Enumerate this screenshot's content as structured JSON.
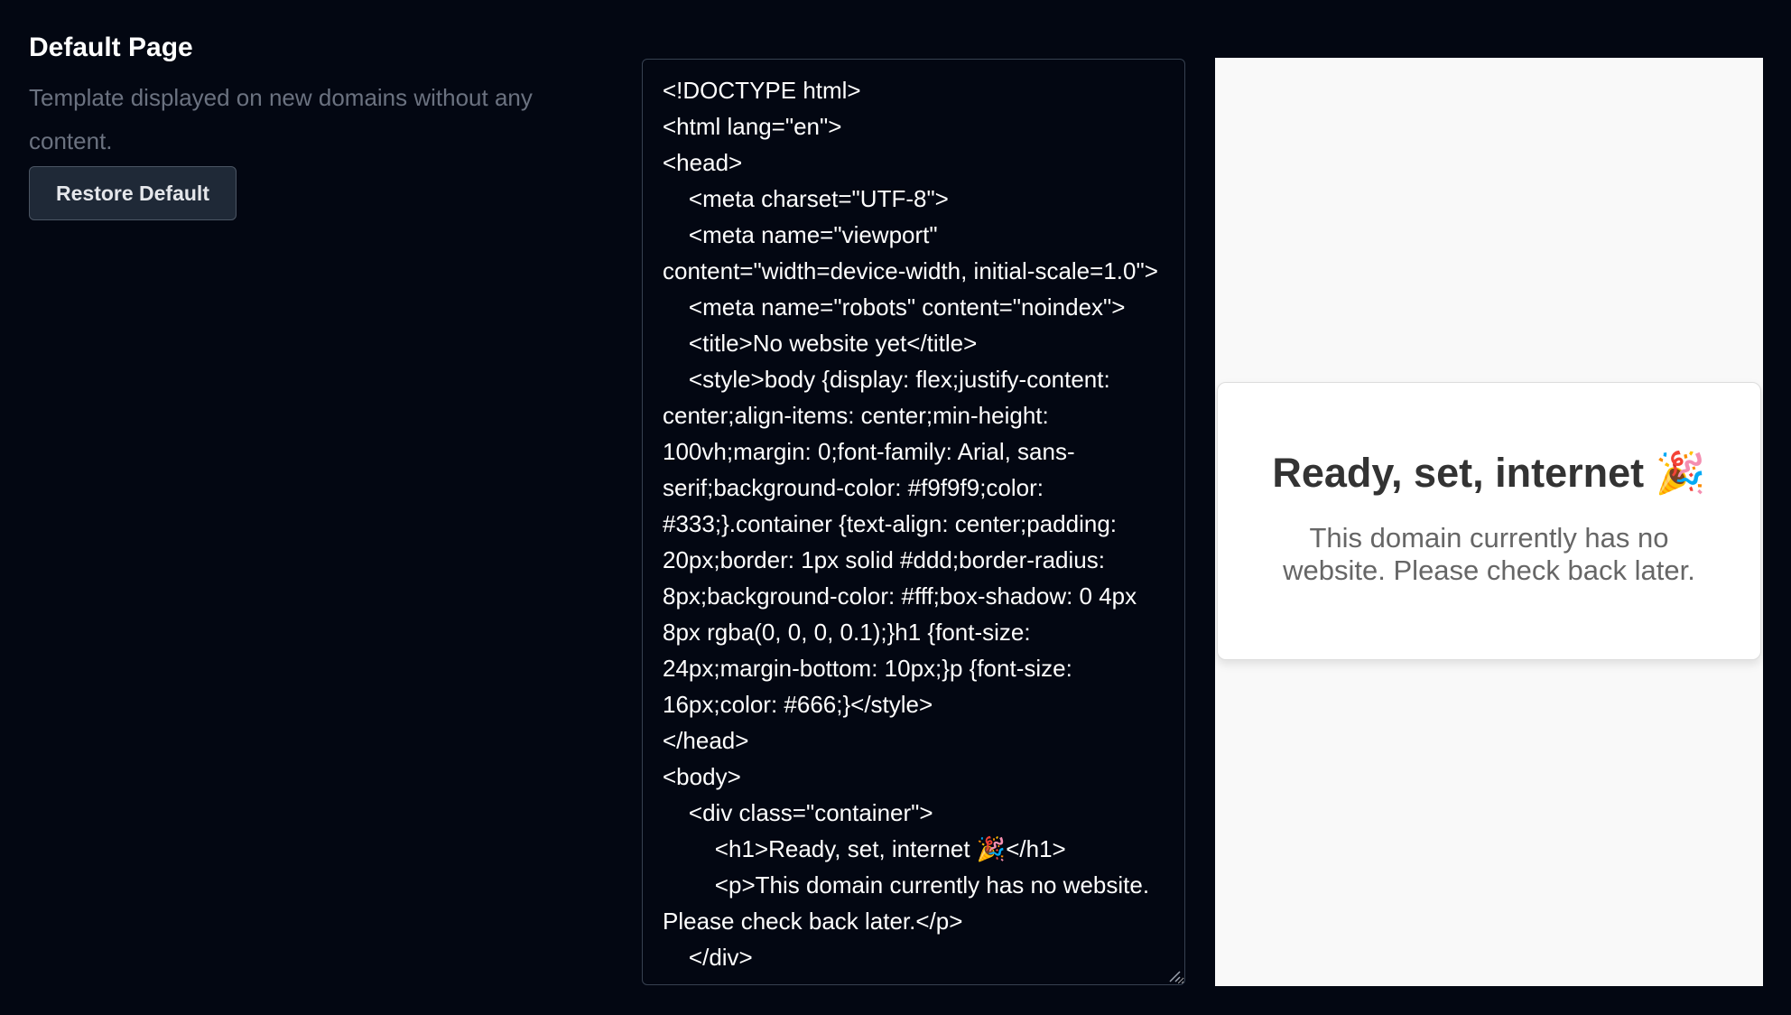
{
  "settings": {
    "title": "Default Page",
    "description": "Template displayed on new domains without any content.",
    "restore_label": "Restore Default"
  },
  "editor": {
    "content": "<!DOCTYPE html>\n<html lang=\"en\">\n<head>\n\t<meta charset=\"UTF-8\">\n\t<meta name=\"viewport\" content=\"width=device-width, initial-scale=1.0\">\n\t<meta name=\"robots\" content=\"noindex\">\n\t<title>No website yet</title>\n\t<style>body {display: flex;justify-content: center;align-items: center;min-height: 100vh;margin: 0;font-family: Arial, sans-serif;background-color: #f9f9f9;color: #333;}.container {text-align: center;padding: 20px;border: 1px solid #ddd;border-radius: 8px;background-color: #fff;box-shadow: 0 4px 8px rgba(0, 0, 0, 0.1);}h1 {font-size: 24px;margin-bottom: 10px;}p {font-size: 16px;color: #666;}</style>\n</head>\n<body>\n\t<div class=\"container\">\n\t\t<h1>Ready, set, internet 🎉</h1>\n\t\t<p>This domain currently has no website. Please check back later.</p>\n\t</div>\n</body>\n</html>"
  },
  "preview": {
    "heading": "Ready, set, internet 🎉",
    "text": "This domain currently has no website. Please check back later."
  },
  "colors": {
    "background": "#030712",
    "button_bg": "#1f2937",
    "muted_text": "#6b7280"
  }
}
